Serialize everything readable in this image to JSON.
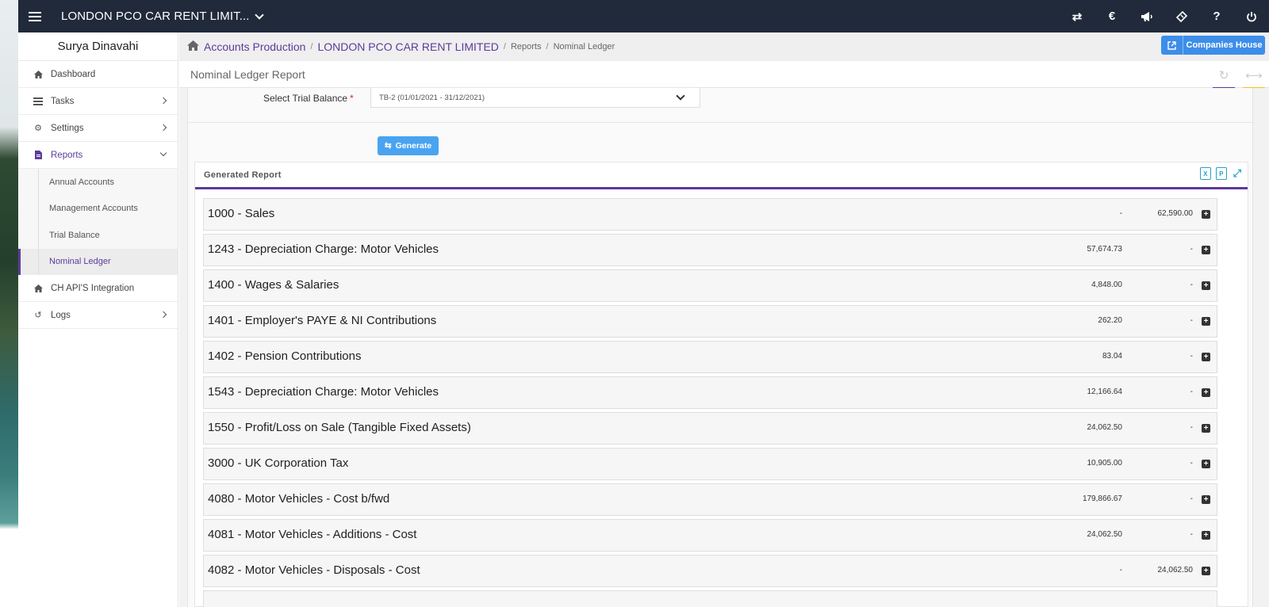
{
  "topbar": {
    "company": "LONDON PCO CAR RENT LIMIT...",
    "icons": [
      "swap-icon",
      "currency-icon",
      "megaphone-icon",
      "ticket-icon",
      "help-icon",
      "power-icon"
    ]
  },
  "sidebar": {
    "user": "Surya Dinavahi",
    "items": [
      {
        "label": "Dashboard",
        "icon": "home-icon"
      },
      {
        "label": "Tasks",
        "icon": "tasks-icon"
      },
      {
        "label": "Settings",
        "icon": "gear-icon"
      },
      {
        "label": "Reports",
        "icon": "document-icon"
      },
      {
        "label": "CH API'S Integration",
        "icon": "home-icon"
      },
      {
        "label": "Logs",
        "icon": "history-icon"
      }
    ],
    "report_subitems": [
      "Annual Accounts",
      "Management Accounts",
      "Trial Balance",
      "Nominal Ledger"
    ]
  },
  "breadcrumb": {
    "items": [
      "Accounts Production",
      "LONDON PCO CAR RENT LIMITED",
      "Reports",
      "Nominal Ledger"
    ]
  },
  "companies_house_button": "Companies House",
  "page_title": "Nominal Ledger Report",
  "form": {
    "label": "Select Trial Balance",
    "required_marker": "*",
    "selected_value": "TB-2 (01/01/2021 - 31/12/2021)",
    "generate_label": "Generate"
  },
  "report": {
    "title": "Generated Report",
    "rows": [
      {
        "name": "1000 - Sales",
        "debit": "-",
        "credit": "62,590.00"
      },
      {
        "name": "1243 - Depreciation Charge: Motor Vehicles",
        "debit": "57,674.73",
        "credit": "-"
      },
      {
        "name": "1400 - Wages & Salaries",
        "debit": "4,848.00",
        "credit": "-"
      },
      {
        "name": "1401 - Employer's PAYE & NI Contributions",
        "debit": "262.20",
        "credit": "-"
      },
      {
        "name": "1402 - Pension Contributions",
        "debit": "83.04",
        "credit": "-"
      },
      {
        "name": "1543 - Depreciation Charge: Motor Vehicles",
        "debit": "12,166.64",
        "credit": "-"
      },
      {
        "name": "1550 - Profit/Loss on Sale (Tangible Fixed Assets)",
        "debit": "24,062.50",
        "credit": "-"
      },
      {
        "name": "3000 - UK Corporation Tax",
        "debit": "10,905.00",
        "credit": "-"
      },
      {
        "name": "4080 - Motor Vehicles - Cost b/fwd",
        "debit": "179,866.67",
        "credit": "-"
      },
      {
        "name": "4081 - Motor Vehicles - Additions - Cost",
        "debit": "24,062.50",
        "credit": "-"
      },
      {
        "name": "4082 - Motor Vehicles - Disposals - Cost",
        "debit": "-",
        "credit": "24,062.50"
      }
    ]
  },
  "colors": {
    "topbar": "#212a3b",
    "accent_purple": "#5d3a9b",
    "button_blue": "#4aa3f0",
    "companies_house_blue": "#3d8ee8",
    "yellow_tab": "#f0c419"
  }
}
